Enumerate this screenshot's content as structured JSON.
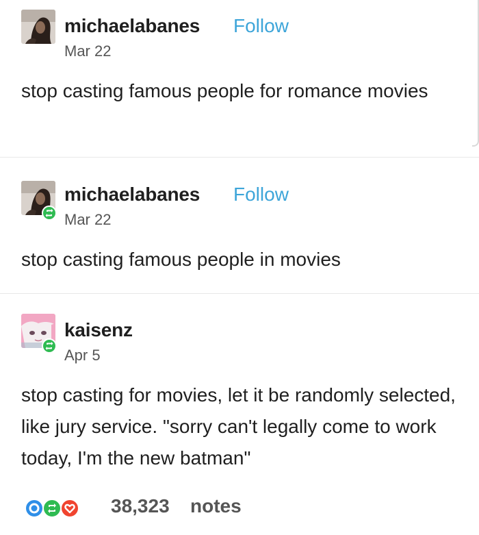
{
  "colors": {
    "follow_link": "#3da5d9",
    "reblog_badge": "#2fbb52",
    "reply_icon": "#2f8fe8",
    "like_icon": "#f0442f",
    "notes_text": "#555555"
  },
  "posts": [
    {
      "username": "michaelabanes",
      "follow_label": "Follow",
      "date": "Mar 22",
      "body": "stop casting famous people for romance movies",
      "avatar_icon": "user-avatar-photo",
      "reblogged": false
    },
    {
      "username": "michaelabanes",
      "follow_label": "Follow",
      "date": "Mar 22",
      "body": "stop casting famous people in movies",
      "avatar_icon": "user-avatar-photo",
      "reblogged": true
    },
    {
      "username": "kaisenz",
      "date": "Apr 5",
      "body": "stop casting for movies, let it be randomly selected, like jury service. \"sorry can't legally come to work today, I'm the new batman\"",
      "avatar_icon": "anime-avatar",
      "reblogged": true
    }
  ],
  "footer": {
    "notes_count": "38,323",
    "notes_label": "notes",
    "icons": [
      "reply-icon",
      "reblog-icon",
      "like-icon"
    ]
  }
}
